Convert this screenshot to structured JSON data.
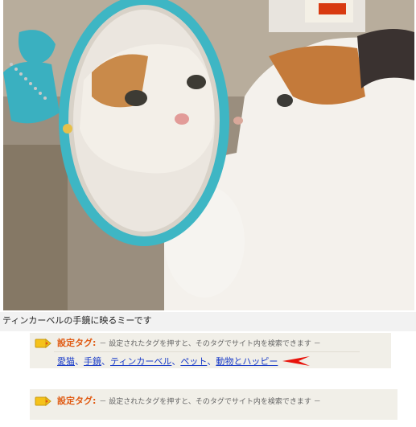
{
  "photo": {
    "icon": "calico-cat-mirror-photo"
  },
  "caption": "ティンカーベルの手鏡に映るミーです",
  "tag_sections": [
    {
      "title": "設定タグ:",
      "description": "－ 設定されたタグを押すと、そのタグでサイト内を検索できます －",
      "tags": [
        "愛猫",
        "手鏡",
        "ティンカーベル",
        "ペット",
        "動物とハッピー"
      ],
      "separator": "、"
    },
    {
      "title": "設定タグ:",
      "description": "－ 設定されたタグを押すと、そのタグでサイト内を検索できます －"
    }
  ],
  "colors": {
    "tag_title": "#e05a12",
    "tag_link": "#1a3cc8",
    "arrow": "#e8140c",
    "tag_box": "#f1efe8"
  }
}
